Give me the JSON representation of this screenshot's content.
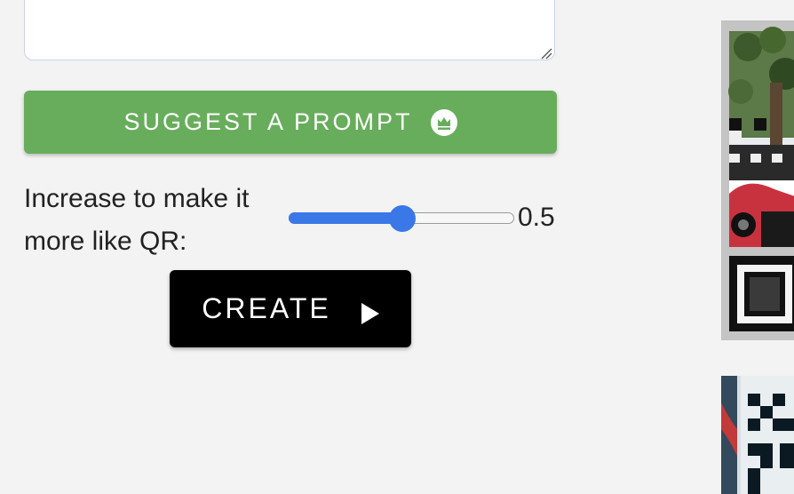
{
  "prompt_box": {
    "value": ""
  },
  "suggest_button": {
    "label": "SUGGEST A PROMPT",
    "icon": "crown-icon",
    "color": "#68ad5c"
  },
  "qr_strength": {
    "label": "Increase to make it more like QR:",
    "value": 0.5,
    "value_text": "0.5",
    "min": 0,
    "max": 1,
    "accent": "#3a78e8"
  },
  "create_button": {
    "label": "CREATE",
    "icon": "play-icon"
  },
  "gallery": {
    "items": [
      {
        "kind": "generated-qr-art"
      },
      {
        "kind": "generated-qr-art"
      }
    ]
  }
}
